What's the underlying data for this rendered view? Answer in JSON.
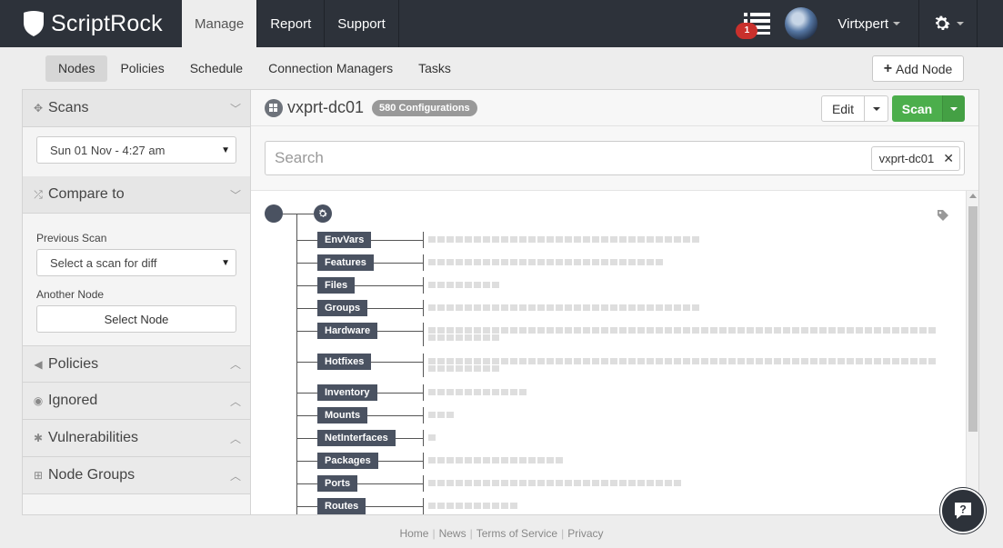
{
  "brand": {
    "name": "ScriptRock"
  },
  "topnav": {
    "tabs": [
      {
        "label": "Manage",
        "active": true
      },
      {
        "label": "Report",
        "active": false
      },
      {
        "label": "Support",
        "active": false
      }
    ],
    "task_badge": "1",
    "user": "Virtxpert"
  },
  "subnav": {
    "tabs": [
      "Nodes",
      "Policies",
      "Schedule",
      "Connection Managers",
      "Tasks"
    ],
    "active": "Nodes",
    "add_node": "Add Node"
  },
  "sidebar": {
    "scans": {
      "title": "Scans",
      "selected": "Sun 01 Nov - 4:27 am"
    },
    "compare": {
      "title": "Compare to",
      "previous_label": "Previous Scan",
      "previous_placeholder": "Select a scan for diff",
      "another_label": "Another Node",
      "select_node": "Select Node"
    },
    "sections": [
      {
        "title": "Policies",
        "icon": "megaphone-icon"
      },
      {
        "title": "Ignored",
        "icon": "eye-slash-icon"
      },
      {
        "title": "Vulnerabilities",
        "icon": "bug-icon"
      },
      {
        "title": "Node Groups",
        "icon": "grid-icon"
      }
    ]
  },
  "node": {
    "name": "vxprt-dc01",
    "configurations": "580 Configurations",
    "edit": "Edit",
    "scan": "Scan"
  },
  "search": {
    "placeholder": "Search",
    "chip": "vxprt-dc01"
  },
  "tree": {
    "categories": [
      "EnvVars",
      "Features",
      "Files",
      "Groups",
      "Hardware",
      "Hotfixes",
      "Inventory",
      "Mounts",
      "NetInterfaces",
      "Packages",
      "Ports",
      "Routes"
    ],
    "item_counts": [
      30,
      26,
      8,
      30,
      64,
      64,
      11,
      3,
      1,
      15,
      28,
      10
    ]
  },
  "footer": {
    "links": [
      "Home",
      "News",
      "Terms of Service",
      "Privacy"
    ]
  },
  "colors": {
    "topbar": "#2d323a",
    "scan_green": "#4cae4c",
    "category_tag": "#4a5261",
    "badge_red": "#c9302c"
  }
}
